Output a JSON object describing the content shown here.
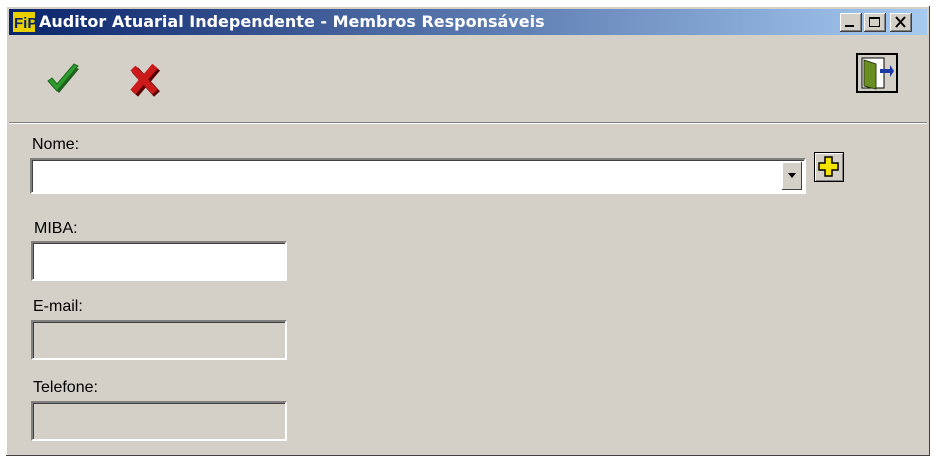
{
  "window": {
    "title": "Auditor Atuarial Independente - Membros Responsáveis",
    "app_icon": "fip-logo",
    "controls": [
      "minimize",
      "maximize",
      "close"
    ]
  },
  "toolbar": {
    "confirm_icon": "check-icon",
    "cancel_icon": "x-icon",
    "exit_icon": "exit-door-icon"
  },
  "form": {
    "nome": {
      "label": "Nome:",
      "value": ""
    },
    "miba": {
      "label": "MIBA:",
      "value": ""
    },
    "email": {
      "label": "E-mail:",
      "value": ""
    },
    "telefone": {
      "label": "Telefone:",
      "value": ""
    },
    "add_icon": "plus-icon"
  },
  "colors": {
    "titlebar_start": "#0a246a",
    "titlebar_end": "#a6caf0",
    "window_bg": "#d4d0c8",
    "confirm": "#2e8b2e",
    "cancel": "#c0181a"
  }
}
